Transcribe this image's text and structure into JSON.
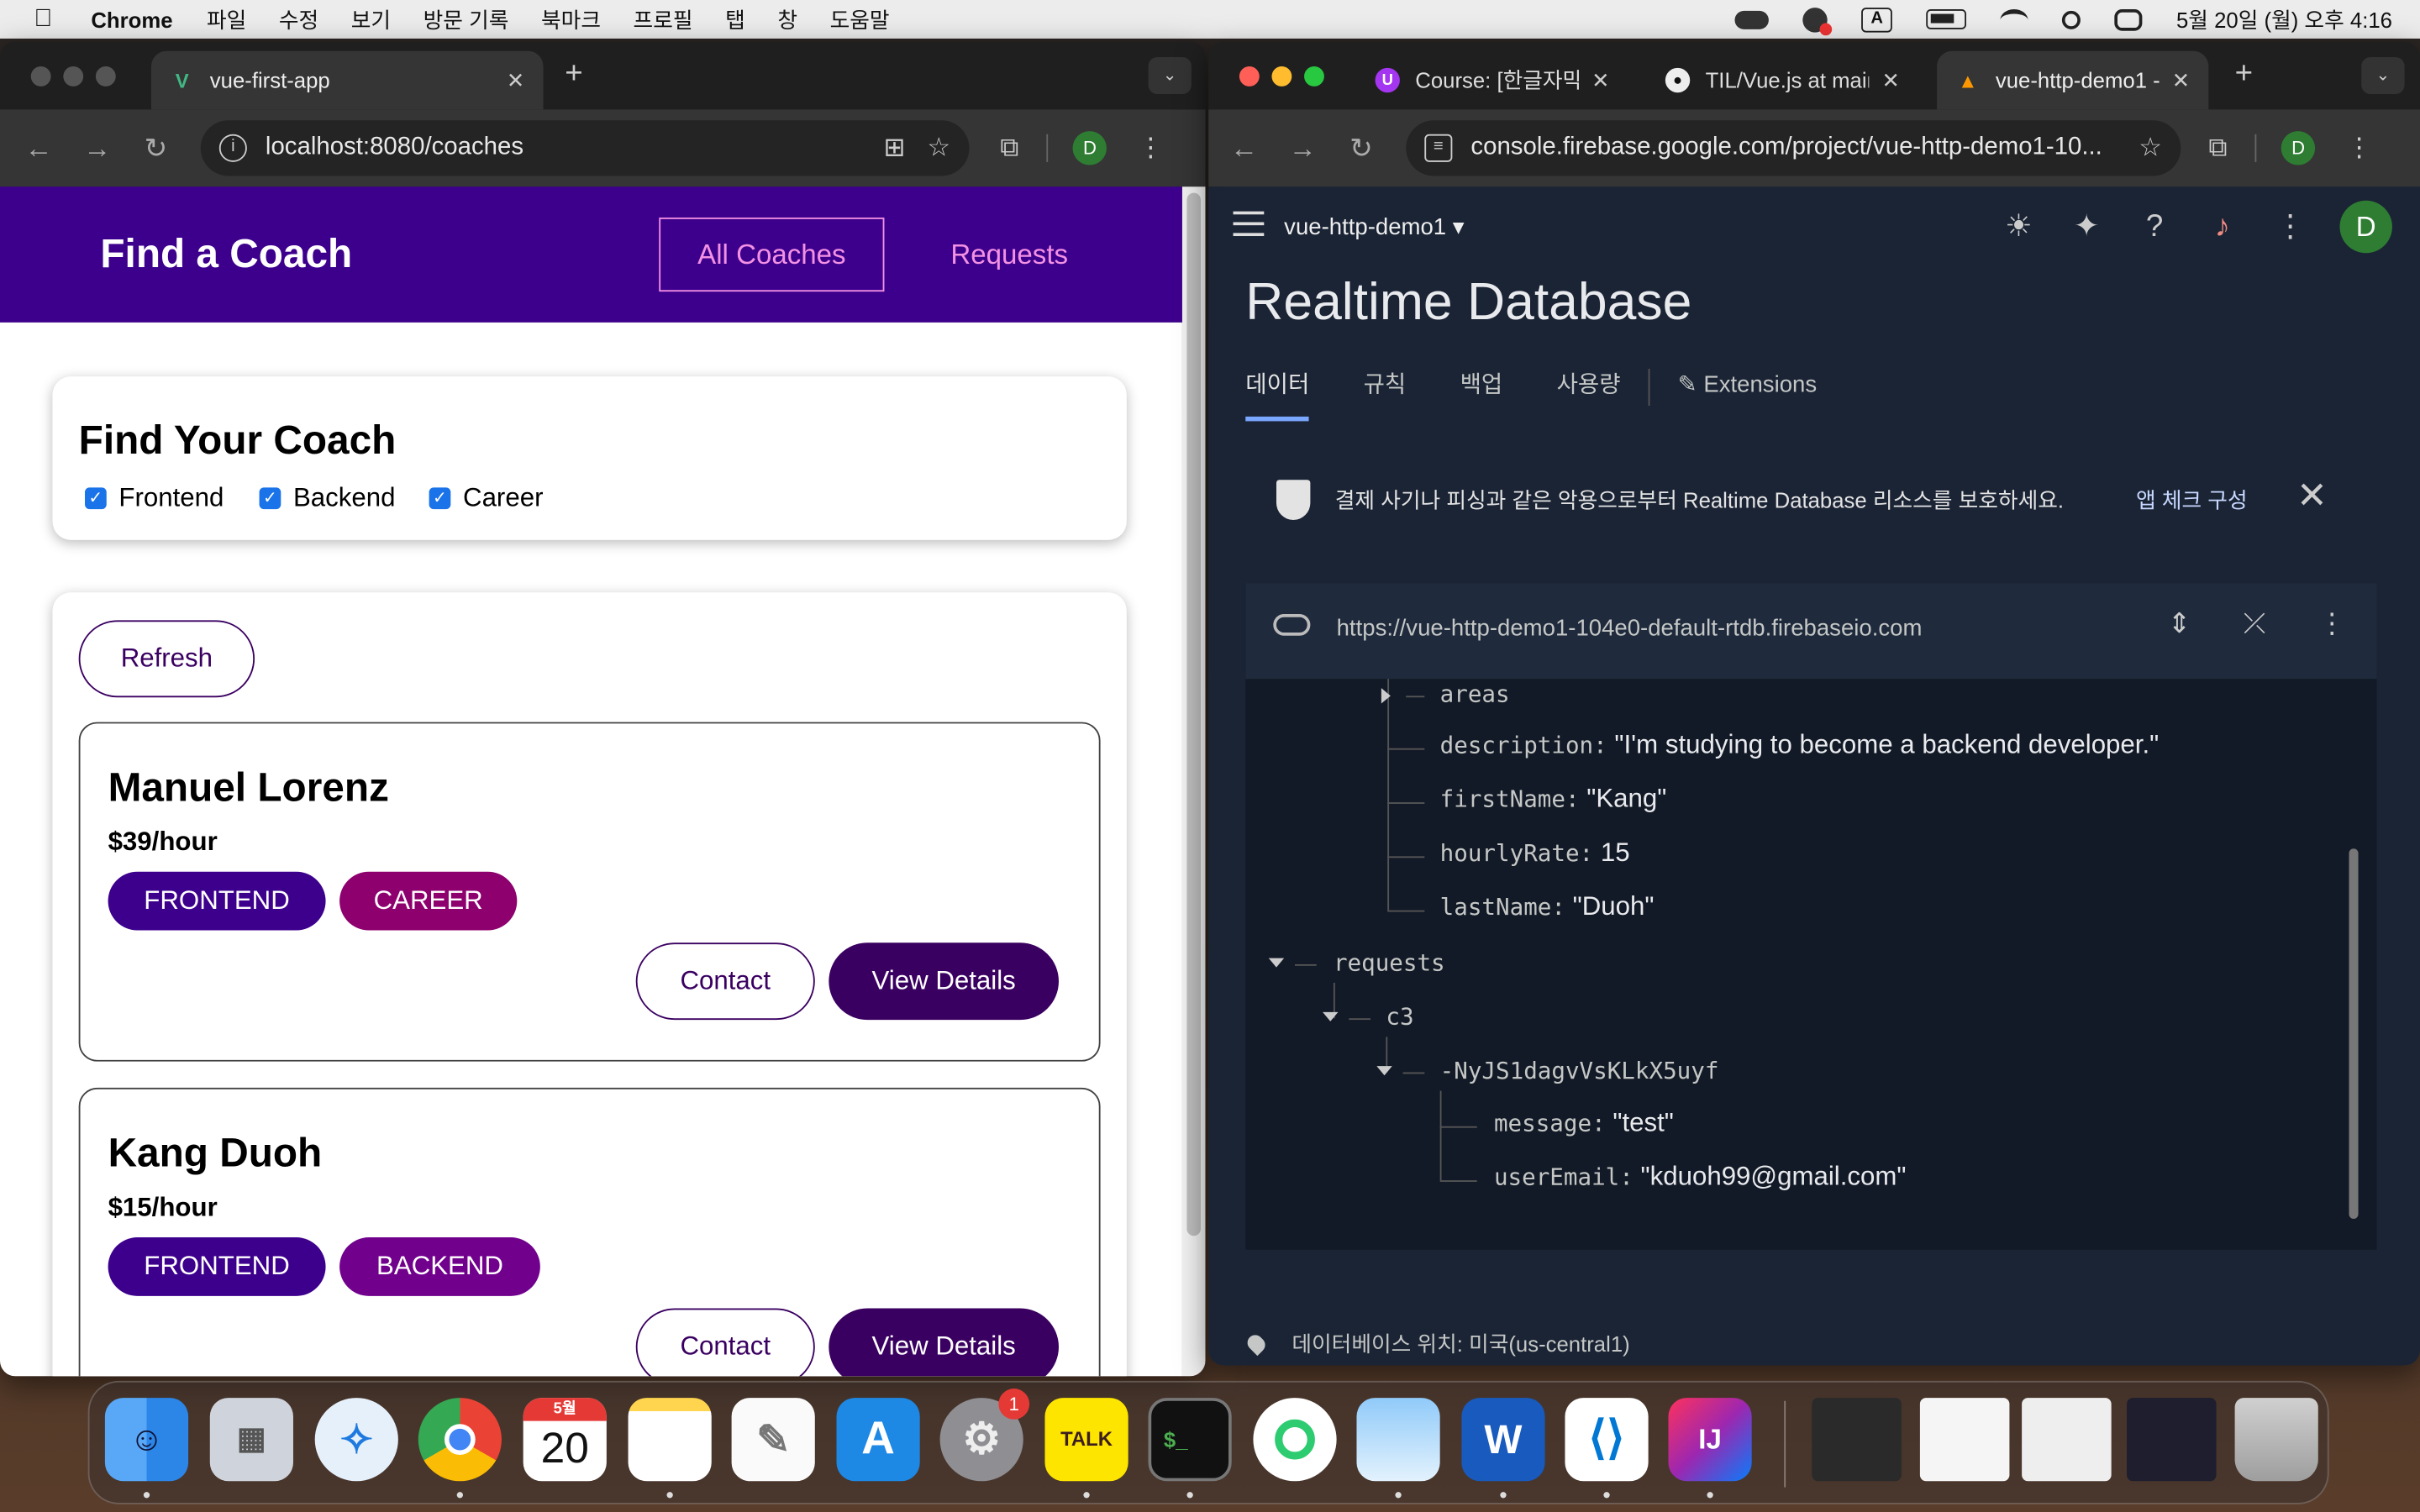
{
  "menubar": {
    "app_name": "Chrome",
    "items": [
      "파일",
      "수정",
      "보기",
      "방문 기록",
      "북마크",
      "프로필",
      "탭",
      "창",
      "도움말"
    ],
    "clock": "5월 20일 (월) 오후 4:16",
    "input_indicator": "A"
  },
  "left_window": {
    "tab_title": "vue-first-app",
    "url": "localhost:8080/coaches",
    "profile_initial": "D",
    "app": {
      "brand": "Find a Coach",
      "nav": [
        "All Coaches",
        "Requests"
      ],
      "filter_title": "Find Your Coach",
      "filters": [
        {
          "label": "Frontend",
          "checked": true
        },
        {
          "label": "Backend",
          "checked": true
        },
        {
          "label": "Career",
          "checked": true
        }
      ],
      "refresh_label": "Refresh",
      "contact_label": "Contact",
      "details_label": "View Details",
      "coaches": [
        {
          "name": "Manuel Lorenz",
          "rate": "$39/hour",
          "areas": [
            "FRONTEND",
            "CAREER"
          ]
        },
        {
          "name": "Kang Duoh",
          "rate": "$15/hour",
          "areas": [
            "FRONTEND",
            "BACKEND"
          ]
        }
      ]
    },
    "colors": {
      "header": "#3d008d",
      "accent": "#f391e3",
      "button": "#3a0061",
      "frontend": "#3d008d",
      "career": "#8d006e",
      "backend": "#71008d"
    }
  },
  "right_window": {
    "tabs": [
      {
        "title": "Course: [한글자막]",
        "icon": "udemy-icon"
      },
      {
        "title": "TIL/Vue.js at main",
        "icon": "github-icon"
      },
      {
        "title": "vue-http-demo1 -",
        "icon": "firebase-icon"
      }
    ],
    "url": "console.firebase.google.com/project/vue-http-demo1-10...",
    "profile_initial": "D",
    "firebase": {
      "project": "vue-http-demo1",
      "page_title": "Realtime Database",
      "tabs": [
        "데이터",
        "규칙",
        "백업",
        "사용량",
        "Extensions"
      ],
      "banner_text": "결제 사기나 피싱과 같은 악용으로부터 Realtime Database 리소스를 보호하세요.",
      "banner_link": "앱 체크 구성",
      "db_url": "https://vue-http-demo1-104e0-default-rtdb.firebaseio.com",
      "tree": {
        "areas_key": "areas",
        "description_key": "description:",
        "description_val": "\"I'm studying to become a backend developer.\"",
        "firstName_key": "firstName:",
        "firstName_val": "\"Kang\"",
        "hourlyRate_key": "hourlyRate:",
        "hourlyRate_val": "15",
        "lastName_key": "lastName:",
        "lastName_val": "\"Duoh\"",
        "requests_key": "requests",
        "c3_key": "c3",
        "push_key": "-NyJS1dagvVsKLkX5uyf",
        "message_key": "message:",
        "message_val": "\"test\"",
        "userEmail_key": "userEmail:",
        "userEmail_val": "\"kduoh99@gmail.com\""
      },
      "footer": "데이터베이스 위치: 미국(us-central1)"
    }
  },
  "dock": {
    "calendar_month": "5월",
    "calendar_day": "20",
    "settings_badge": "1",
    "kakao_label": "TALK",
    "word_label": "W",
    "intellij_label": "IJ"
  }
}
